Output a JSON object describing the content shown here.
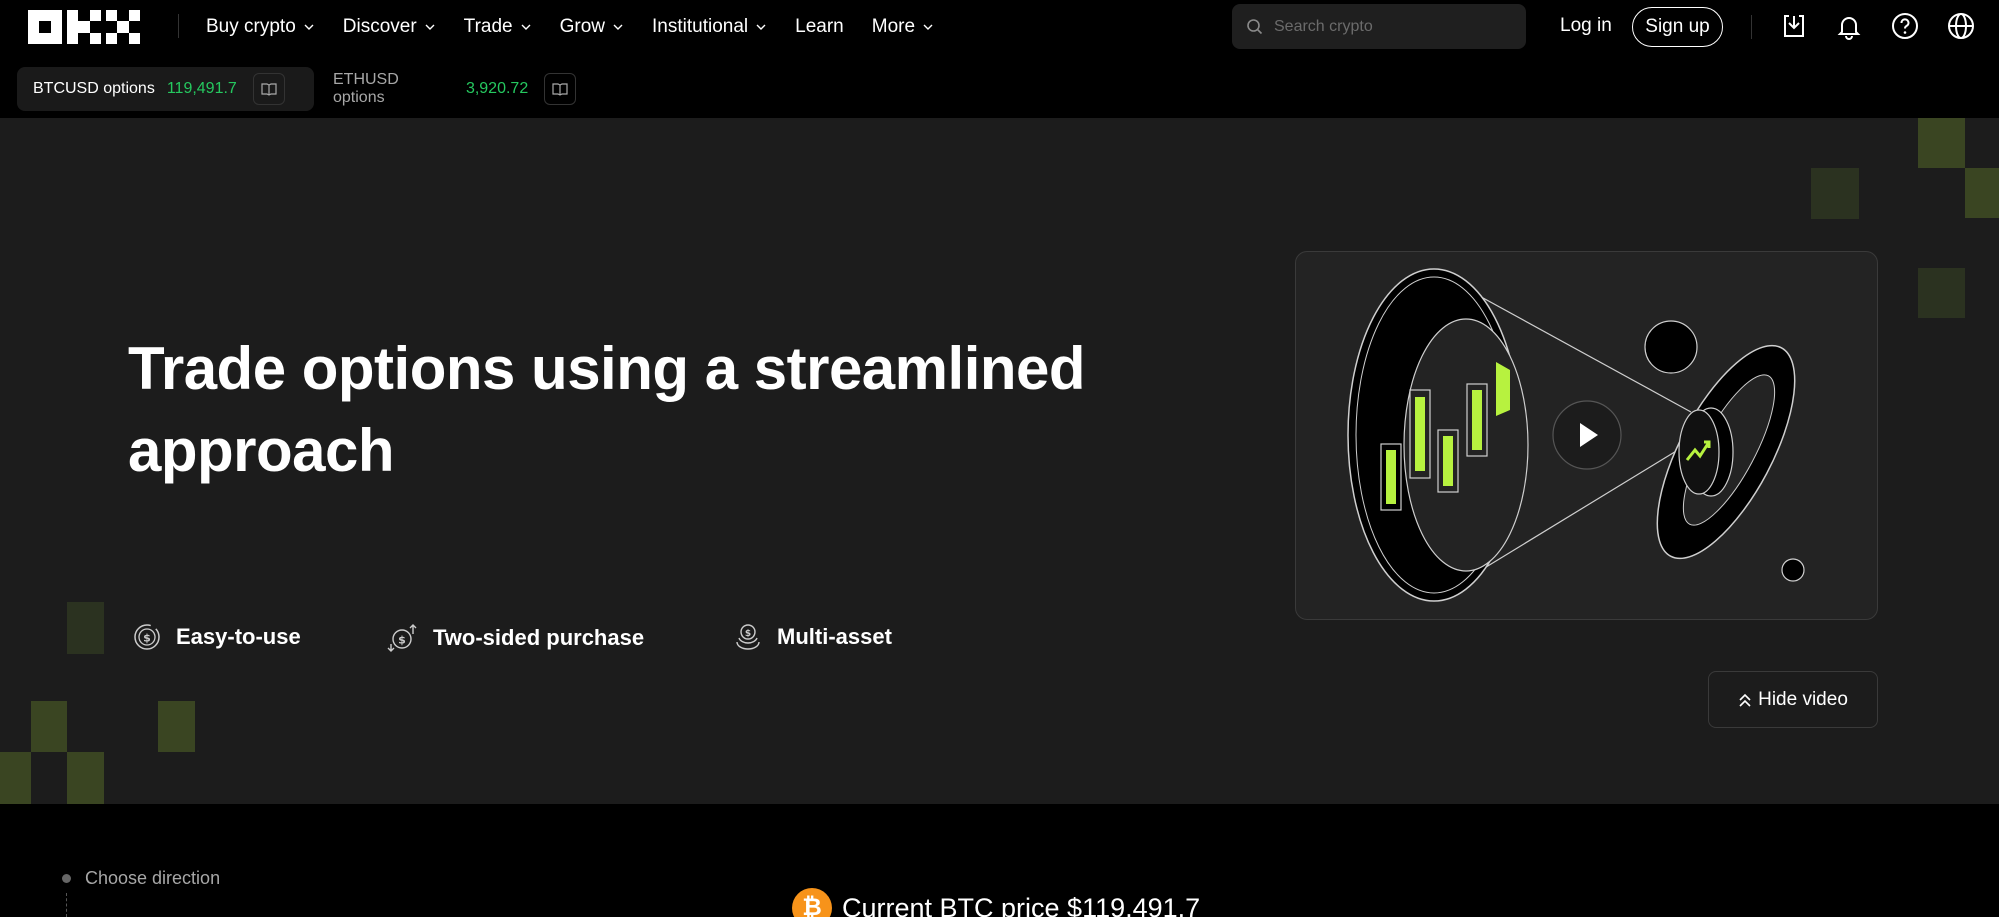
{
  "nav": {
    "menu": [
      {
        "label": "Buy crypto",
        "dropdown": true
      },
      {
        "label": "Discover",
        "dropdown": true
      },
      {
        "label": "Trade",
        "dropdown": true
      },
      {
        "label": "Grow",
        "dropdown": true
      },
      {
        "label": "Institutional",
        "dropdown": true
      },
      {
        "label": "Learn",
        "dropdown": false
      },
      {
        "label": "More",
        "dropdown": true
      }
    ],
    "search_placeholder": "Search crypto",
    "login_label": "Log in",
    "signup_label": "Sign up",
    "icons": [
      "download-icon",
      "bell-icon",
      "help-icon",
      "globe-icon"
    ]
  },
  "tickers": [
    {
      "name": "BTCUSD options",
      "price": "119,491.7",
      "active": true
    },
    {
      "name": "ETHUSD options",
      "price": "3,920.72",
      "active": false
    }
  ],
  "hero": {
    "title": "Trade options using a streamlined approach",
    "features": [
      {
        "label": "Easy-to-use",
        "icon": "dollar-coin-icon"
      },
      {
        "label": "Two-sided purchase",
        "icon": "coin-arrows-icon"
      },
      {
        "label": "Multi-asset",
        "icon": "stacked-coins-icon"
      }
    ],
    "hide_video_label": "Hide video"
  },
  "bottom": {
    "step_label": "Choose direction",
    "current_price_text": "Current BTC price $119,491.7",
    "coin_symbol": "₿"
  },
  "colors": {
    "accent_green": "#25c85f",
    "lime": "#b7f23f",
    "hero_bg": "#1c1c1c",
    "btc_orange": "#f7931a"
  }
}
